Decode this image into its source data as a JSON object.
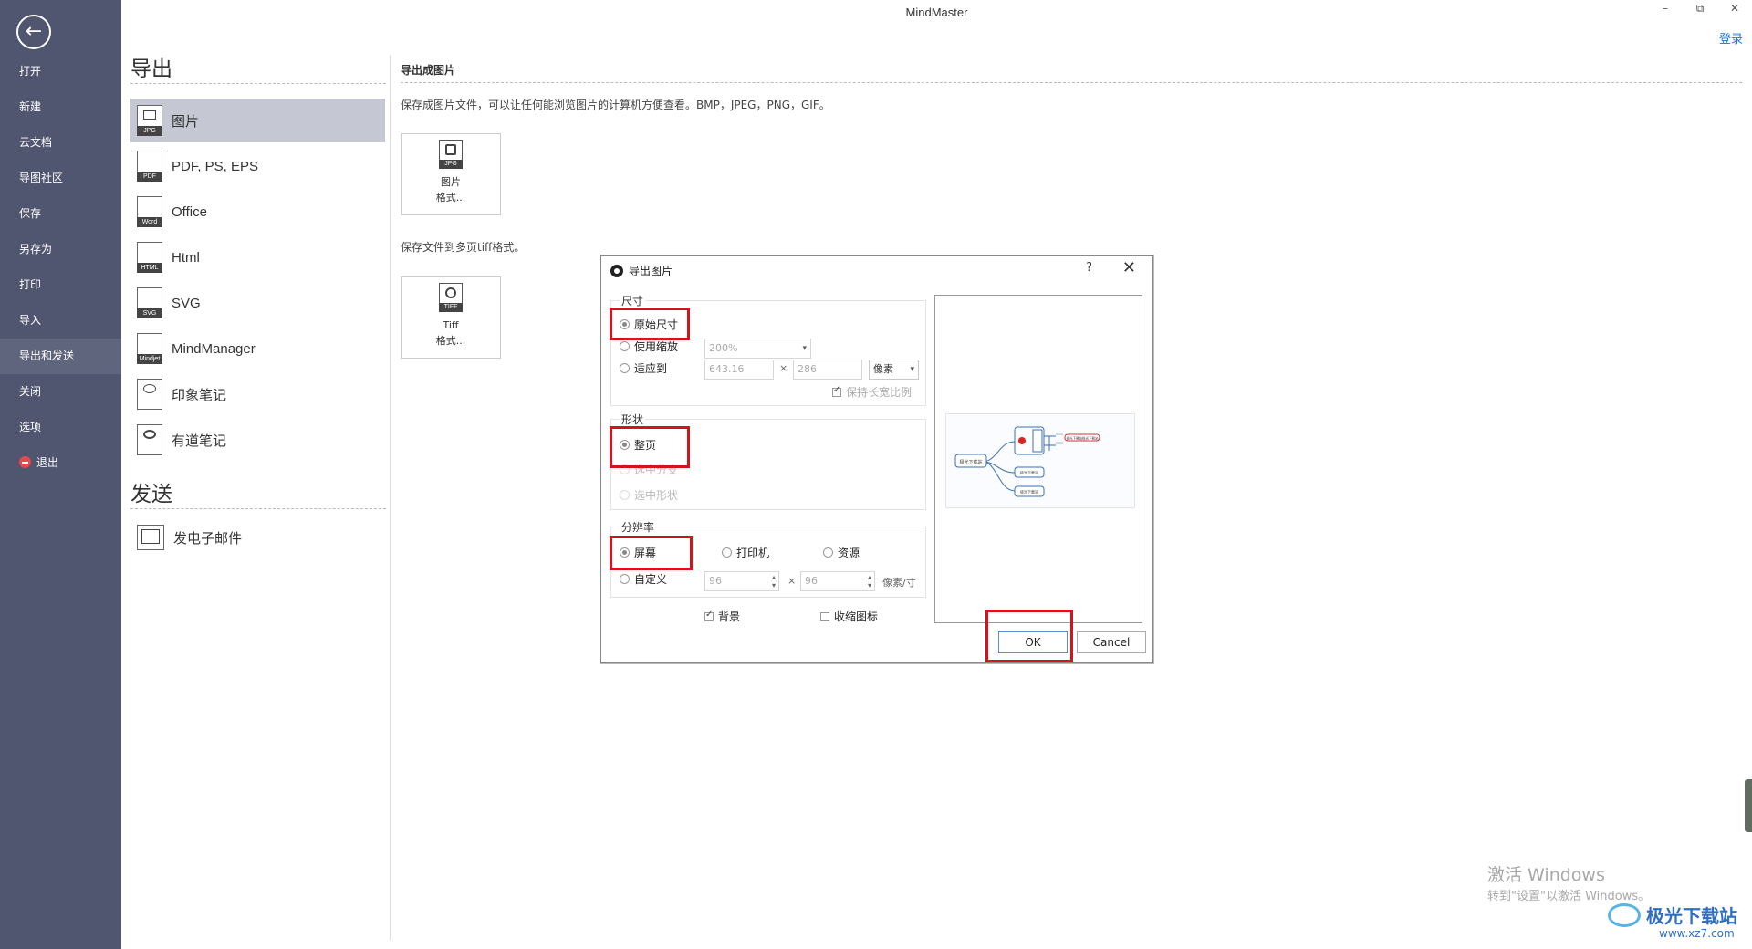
{
  "app": {
    "title": "MindMaster",
    "login": "登录",
    "minimize": "–",
    "restore": "⧉",
    "close": "✕"
  },
  "sidebar": {
    "back": "←",
    "items": [
      {
        "label": "打开"
      },
      {
        "label": "新建"
      },
      {
        "label": "云文档"
      },
      {
        "label": "导图社区"
      },
      {
        "label": "保存"
      },
      {
        "label": "另存为"
      },
      {
        "label": "打印"
      },
      {
        "label": "导入"
      },
      {
        "label": "导出和发送"
      },
      {
        "label": "关闭"
      },
      {
        "label": "选项"
      },
      {
        "label": "退出"
      }
    ]
  },
  "export_panel": {
    "title": "导出",
    "formats": [
      {
        "label": "图片",
        "tag": "JPG"
      },
      {
        "label": "PDF, PS, EPS",
        "tag": "PDF"
      },
      {
        "label": "Office",
        "tag": "Word"
      },
      {
        "label": "Html",
        "tag": "HTML"
      },
      {
        "label": "SVG",
        "tag": "SVG"
      },
      {
        "label": "MindManager",
        "tag": "Mindjet"
      },
      {
        "label": "印象笔记",
        "tag": ""
      },
      {
        "label": "有道笔记",
        "tag": ""
      }
    ],
    "send_title": "发送",
    "send_items": [
      {
        "label": "发电子邮件"
      }
    ]
  },
  "content": {
    "heading": "导出成图片",
    "desc1": "保存成图片文件，可以让任何能浏览图片的计算机方便查看。BMP，JPEG，PNG，GIF。",
    "box1_tag": "JPG",
    "box1_line1": "图片",
    "box1_line2": "格式...",
    "desc2": "保存文件到多页tiff格式。",
    "box2_tag": "TIFF",
    "box2_line1": "Tiff",
    "box2_line2": "格式..."
  },
  "dialog": {
    "title": "导出图片",
    "help": "?",
    "close": "✕",
    "size_group": "尺寸",
    "size_original": "原始尺寸",
    "size_scale": "使用缩放",
    "scale_value": "200%",
    "size_fit": "适应到",
    "fit_width": "643.16",
    "times": "×",
    "fit_height": "286",
    "unit": "像素",
    "keep_ratio": "保持长宽比例",
    "shape_group": "形状",
    "shape_page": "整页",
    "shape_branch": "选中分支",
    "shape_selected": "选中形状",
    "res_group": "分辨率",
    "res_screen": "屏幕",
    "res_printer": "打印机",
    "res_source": "资源",
    "res_custom": "自定义",
    "dpi_x": "96",
    "dpi_y": "96",
    "dpi_unit": "像素/寸",
    "background": "背景",
    "collapse_icon": "收缩图标",
    "ok": "OK",
    "cancel": "Cancel",
    "preview_nodes": {
      "root": "极光下载站",
      "n1": "极光下载站",
      "n2": "极光下载站",
      "n3": "极光下载站",
      "leaf": "极光下载站极光下载站"
    }
  },
  "watermarks": {
    "activate_title": "激活 Windows",
    "activate_sub": "转到\"设置\"以激活 Windows。",
    "brand": "极光下载站",
    "brand_url": "www.xz7.com"
  },
  "colors": {
    "sidebar": "#515670",
    "highlight": "#d4141c",
    "link": "#1a73d9"
  }
}
